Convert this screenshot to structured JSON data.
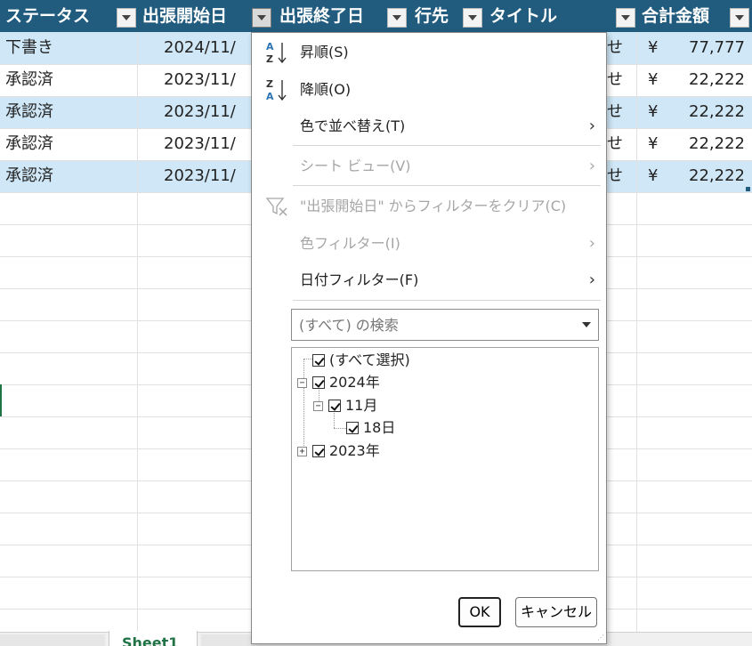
{
  "headers": [
    {
      "label": "ステータス",
      "filter_active": false
    },
    {
      "label": "出張開始日",
      "filter_active": true
    },
    {
      "label": "出張終了日",
      "filter_active": false
    },
    {
      "label": "行先",
      "filter_active": false
    },
    {
      "label": "タイトル",
      "filter_active": false
    },
    {
      "label": "合計金額",
      "filter_active": false
    }
  ],
  "rows": [
    {
      "status": "下書き",
      "start": "2024/11/",
      "title_tail": "せ",
      "currency": "¥",
      "amount": "77,777"
    },
    {
      "status": "承認済",
      "start": "2023/11/",
      "title_tail": "せ",
      "currency": "¥",
      "amount": "22,222"
    },
    {
      "status": "承認済",
      "start": "2023/11/",
      "title_tail": "せ",
      "currency": "¥",
      "amount": "22,222"
    },
    {
      "status": "承認済",
      "start": "2023/11/",
      "title_tail": "せ",
      "currency": "¥",
      "amount": "22,222"
    },
    {
      "status": "承認済",
      "start": "2023/11/",
      "title_tail": "せ",
      "currency": "¥",
      "amount": "22,222"
    }
  ],
  "sheet_tab": "Sheet1",
  "menu": {
    "sort_asc": "昇順(S)",
    "sort_desc": "降順(O)",
    "sort_by_color": "色で並べ替え(T)",
    "sheet_view": "シート ビュー(V)",
    "clear_filter": "\"出張開始日\" からフィルターをクリア(C)",
    "color_filter": "色フィルター(I)",
    "date_filter": "日付フィルター(F)",
    "search_placeholder": "(すべて) の検索",
    "tree": {
      "select_all": "(すべて選択)",
      "year_2024": "2024年",
      "month_11": "11月",
      "day_18": "18日",
      "year_2023": "2023年"
    },
    "ok": "OK",
    "cancel": "キャンセル"
  },
  "colors": {
    "header_bg": "#215b7e",
    "band_bg": "#cfe7f6",
    "disabled_text": "#a6a6a6"
  }
}
